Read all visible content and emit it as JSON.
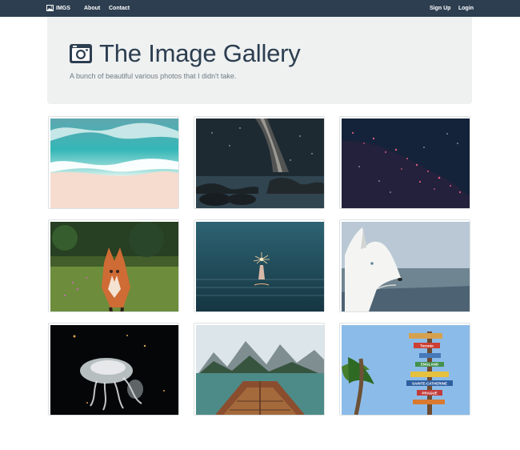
{
  "navbar": {
    "brand": "IMGS",
    "links": [
      "About",
      "Contact"
    ],
    "right_links": [
      "Sign Up",
      "Login"
    ]
  },
  "header": {
    "title": "The Image Gallery",
    "subtitle": "A bunch of beautiful various photos that I didn't take."
  },
  "gallery": {
    "images": [
      {
        "subject": "aerial beach with turquoise waves"
      },
      {
        "subject": "milky way over rocky lake"
      },
      {
        "subject": "starry space nebula"
      },
      {
        "subject": "red fox in grass"
      },
      {
        "subject": "hand holding sparkler above water"
      },
      {
        "subject": "white wolf profile"
      },
      {
        "subject": "glowing jellyfish"
      },
      {
        "subject": "boat bow on mountain lake"
      },
      {
        "subject": "signpost under palm tree"
      }
    ],
    "signpost_text": [
      "Toronto",
      "ENGLAND",
      "SAINTE-CATHERINE",
      "PRAGUE"
    ]
  },
  "colors": {
    "navbar": "#2c3e50",
    "jumbotron": "#eff1f1",
    "title": "#2c3e50",
    "subtitle": "#6f7b84"
  }
}
